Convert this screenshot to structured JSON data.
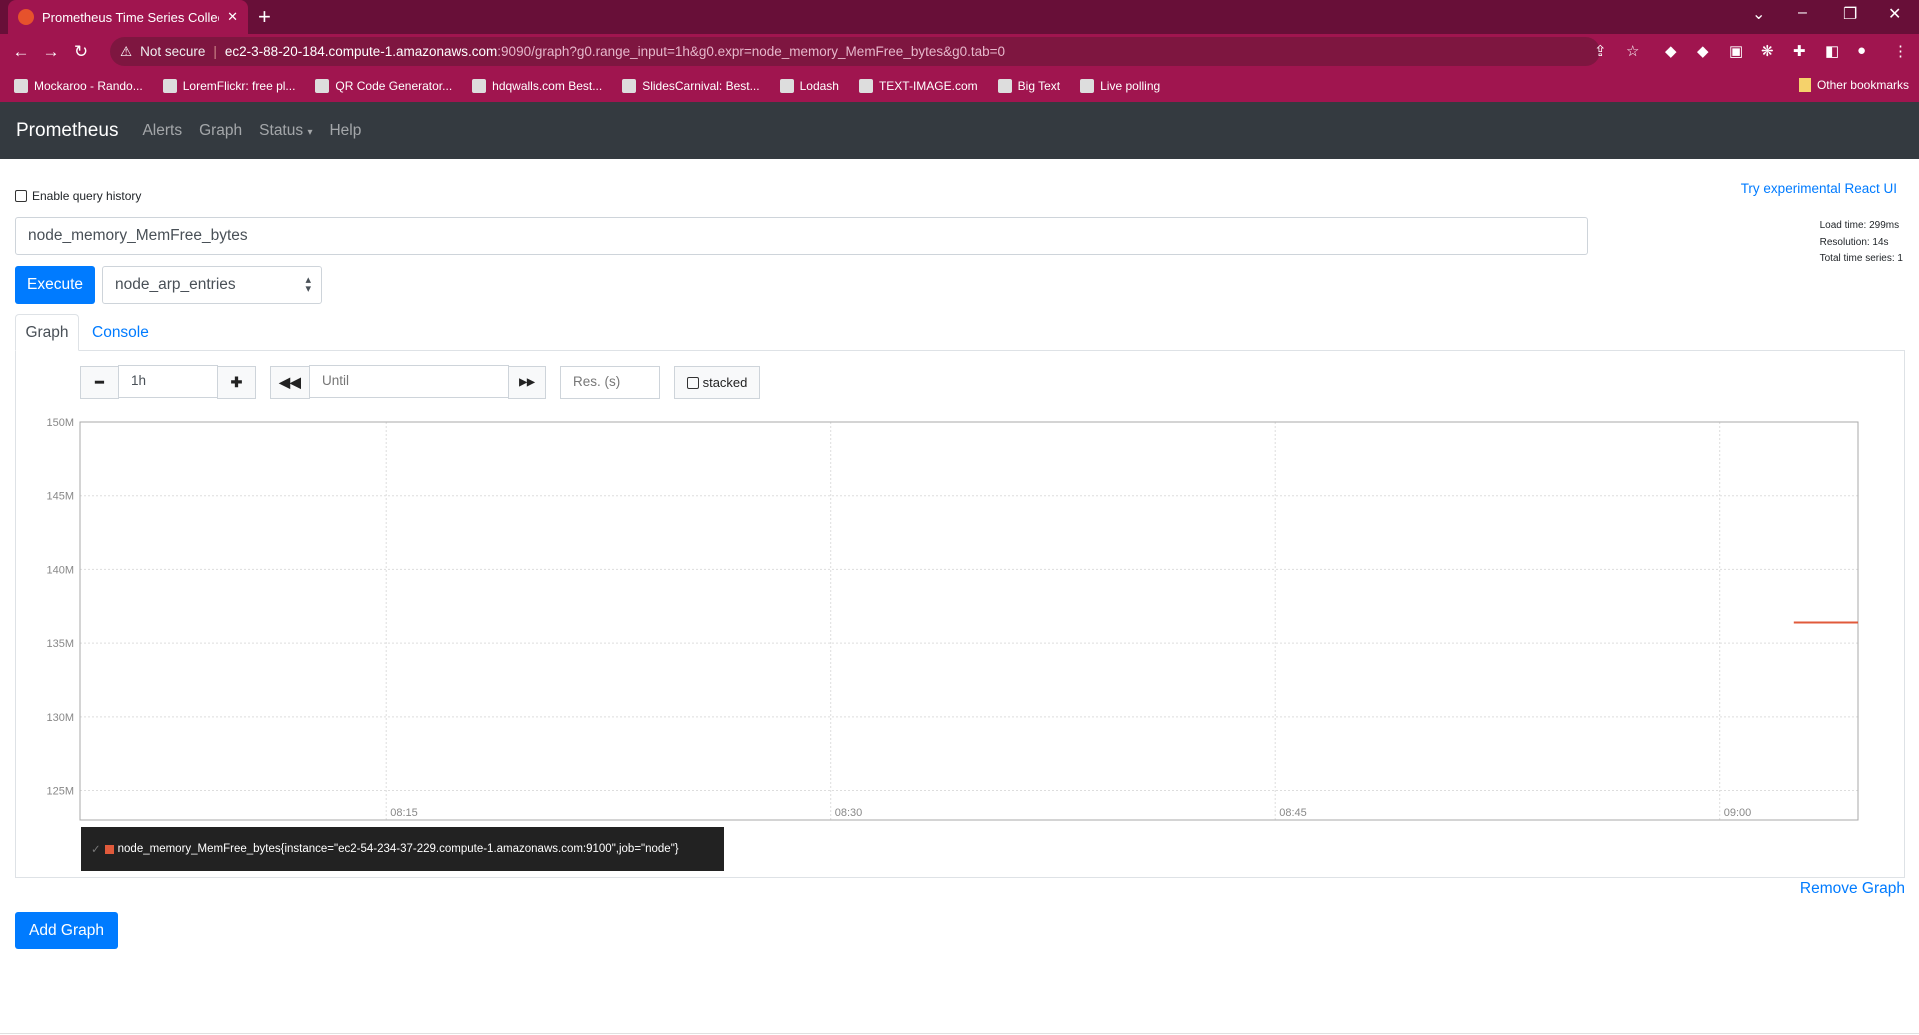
{
  "browser": {
    "tab_title": "Prometheus Time Series Collection and Processing Server",
    "address_not_secure": "Not secure",
    "address_host": "ec2-3-88-20-184.compute-1.amazonaws.com",
    "address_rest": ":9090/graph?g0.range_input=1h&g0.expr=node_memory_MemFree_bytes&g0.tab=0",
    "bookmarks": [
      "Mockaroo - Rando...",
      "LoremFlickr: free pl...",
      "QR Code Generator...",
      "hdqwalls.com Best...",
      "SlidesCarnival: Best...",
      "Lodash",
      "TEXT-IMAGE.com",
      "Big Text",
      "Live polling"
    ],
    "other_bookmarks": "Other bookmarks"
  },
  "nav": {
    "brand": "Prometheus",
    "links": [
      "Alerts",
      "Graph",
      "Status",
      "Help"
    ]
  },
  "page": {
    "enable_history": "Enable query history",
    "react_link": "Try experimental React UI",
    "stats": [
      "Load time: 299ms",
      "Resolution: 14s",
      "Total time series: 1"
    ],
    "query": "node_memory_MemFree_bytes",
    "execute": "Execute",
    "metric_select": "node_arp_entries",
    "tabs": [
      "Graph",
      "Console"
    ],
    "range": "1h",
    "until_placeholder": "Until",
    "res_placeholder": "Res. (s)",
    "stacked": "stacked",
    "remove_graph": "Remove Graph",
    "add_graph": "Add Graph"
  },
  "chart_data": {
    "type": "line",
    "ylim": [
      123000000,
      150000000
    ],
    "yticks": [
      {
        "v": 150000000,
        "l": "150M"
      },
      {
        "v": 145000000,
        "l": "145M"
      },
      {
        "v": 140000000,
        "l": "140M"
      },
      {
        "v": 135000000,
        "l": "135M"
      },
      {
        "v": 130000000,
        "l": "130M"
      },
      {
        "v": 125000000,
        "l": "125M"
      }
    ],
    "xlim": [
      "08:04:40",
      "09:04:40"
    ],
    "xticks": [
      "08:15",
      "08:30",
      "08:45",
      "09:00"
    ],
    "grid": true,
    "legend_placement": "bottom",
    "series": [
      {
        "name": "node_memory_MemFree_bytes{instance=\"ec2-54-234-37-229.compute-1.amazonaws.com:9100\",job=\"node\"}",
        "color": "#e05a3b",
        "x": [
          "09:02:30",
          "09:03:00",
          "09:03:30",
          "09:04:00",
          "09:04:40"
        ],
        "y": [
          136400000,
          136400000,
          136400000,
          136400000,
          136400000
        ]
      }
    ]
  }
}
